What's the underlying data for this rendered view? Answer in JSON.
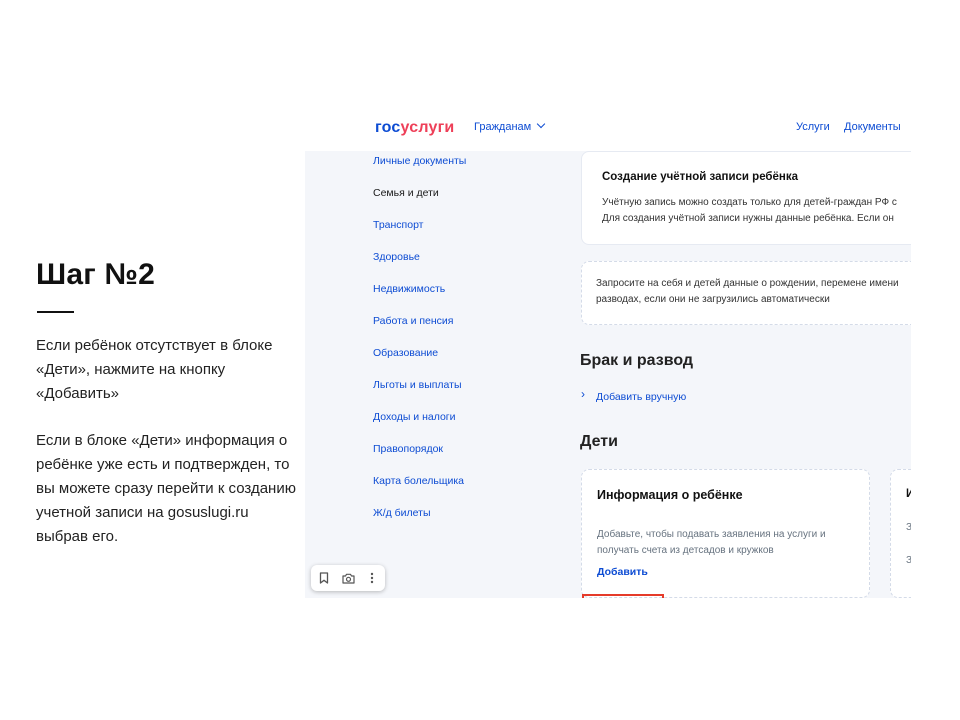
{
  "slide": {
    "title": "Шаг №2",
    "paragraph1": "Если ребёнок отсутствует в блоке «Дети», нажмите на кнопку «Добавить»",
    "paragraph2": "Если в блоке «Дети» информация о ребёнке уже есть и подтвержден, то вы можете сразу перейти к созданию учетной записи на gosuslugi.ru выбрав его."
  },
  "header": {
    "logo_part1": "гос",
    "logo_part2": "услуги",
    "citizens_menu": "Гражданам",
    "nav_links": [
      "Услуги",
      "Документы"
    ]
  },
  "sidebar": {
    "items": [
      "Личные документы",
      "Семья и дети",
      "Транспорт",
      "Здоровье",
      "Недвижимость",
      "Работа и пенсия",
      "Образование",
      "Льготы и выплаты",
      "Доходы и налоги",
      "Правопорядок",
      "Карта болельщика",
      "Ж/д билеты"
    ],
    "active_item": "Семья и дети"
  },
  "main": {
    "account_card": {
      "title": "Создание учётной записи ребёнка",
      "line1": "Учётную запись можно создать только для детей-граждан РФ с",
      "line2": "Для создания учётной записи нужны данные ребёнка. Если он"
    },
    "request_card": {
      "line1": "Запросите на себя и детей данные о рождении, перемене имени",
      "line2": "разводах, если они не загрузились автоматически"
    },
    "marriage_section": {
      "title": "Брак и развод",
      "add_link": "Добавить вручную"
    },
    "children_section": {
      "title": "Дети",
      "card_title": "Информация о ребёнке",
      "card_line1": "Добавьте, чтобы подавать заявления на услуги и",
      "card_line2": "получать счета из детсадов и кружков",
      "add_button": "Добавить",
      "partial_card_title": "И",
      "partial_line1": "З",
      "partial_line2": "З"
    }
  },
  "toolbar": {
    "icons": [
      "bookmark-icon",
      "camera-icon",
      "more-vertical-icon"
    ]
  },
  "colors": {
    "brand_blue": "#0d4cd3",
    "brand_red": "#ee3f58",
    "highlight_red": "#e53b2a",
    "background": "#f4f6fa"
  }
}
